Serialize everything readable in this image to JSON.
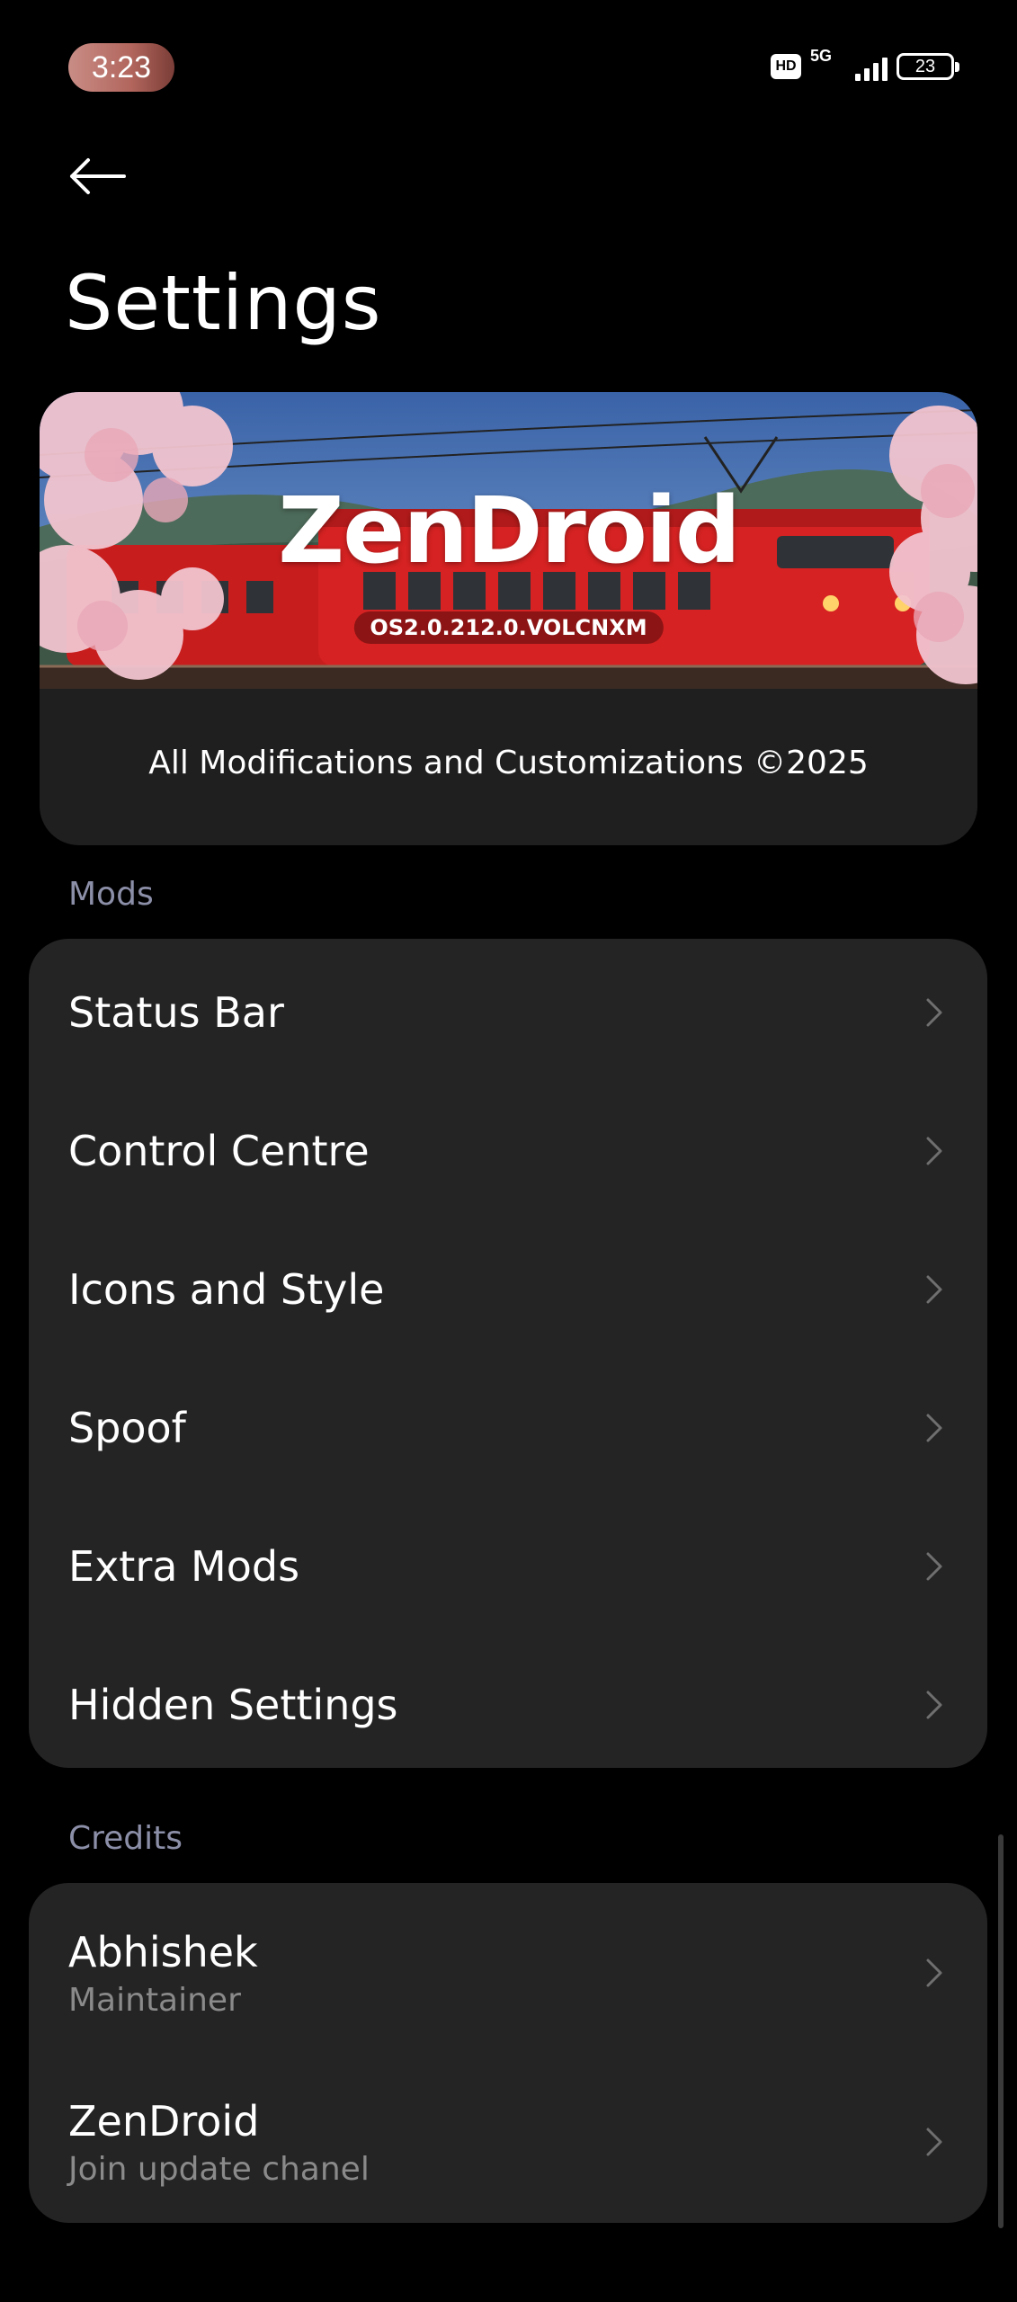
{
  "status_bar": {
    "time": "3:23",
    "hd": "HD",
    "network": "5G",
    "battery": "23"
  },
  "page": {
    "title": "Settings"
  },
  "banner": {
    "brand": "ZenDroid",
    "version": "OS2.0.212.0.VOLCNXM",
    "caption": "All Modifications and Customizations ©2025"
  },
  "sections": {
    "mods_label": "Mods",
    "mods": [
      {
        "label": "Status Bar"
      },
      {
        "label": "Control Centre"
      },
      {
        "label": "Icons and Style"
      },
      {
        "label": "Spoof"
      },
      {
        "label": "Extra Mods"
      },
      {
        "label": "Hidden Settings"
      }
    ],
    "credits_label": "Credits",
    "credits": [
      {
        "label": "Abhishek",
        "sub": "Maintainer"
      },
      {
        "label": "ZenDroid",
        "sub": "Join update chanel"
      }
    ]
  },
  "icons": {
    "back": "back-arrow-icon",
    "chevron": "chevron-right-icon"
  },
  "colors": {
    "background": "#000000",
    "card": "#242424",
    "section_label": "#8c8fa8",
    "subtitle": "#8a8a8a"
  }
}
